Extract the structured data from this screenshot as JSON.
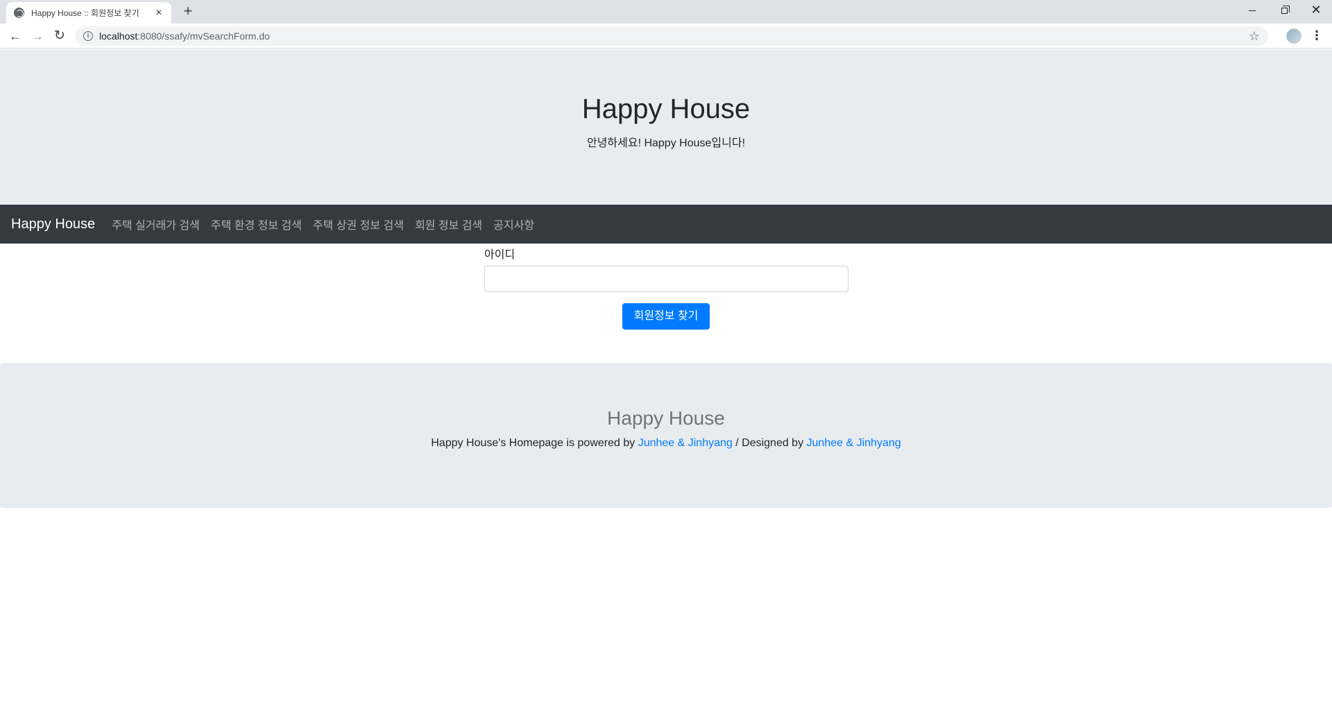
{
  "browser": {
    "tab_title": "Happy House :: 회원정보 찾기",
    "new_tab_label": "+",
    "url_host": "localhost",
    "url_path": ":8080/ssafy/mvSearchForm.do"
  },
  "jumbotron": {
    "title": "Happy House",
    "subtitle": "안녕하세요! Happy House입니다!"
  },
  "navbar": {
    "brand": "Happy House",
    "items": [
      {
        "label": "주택 실거래가 검색"
      },
      {
        "label": "주택 환경 정보 검색"
      },
      {
        "label": "주택 상권 정보 검색"
      },
      {
        "label": "회원 정보 검색"
      },
      {
        "label": "공지사항"
      }
    ]
  },
  "search_form": {
    "id_label": "아이디",
    "id_value": "",
    "submit_label": "회원정보 찾기"
  },
  "footer": {
    "title": "Happy House",
    "text_prefix": "Happy House's Homepage is powered by ",
    "powered_by_link": "Junhee & Jinhyang",
    "text_middle": " / Designed by ",
    "designed_by_link": "Junhee & Jinhyang"
  },
  "colors": {
    "primary": "#007bff",
    "navbar_bg": "#343a40",
    "jumbotron_bg": "#e9ecef"
  }
}
